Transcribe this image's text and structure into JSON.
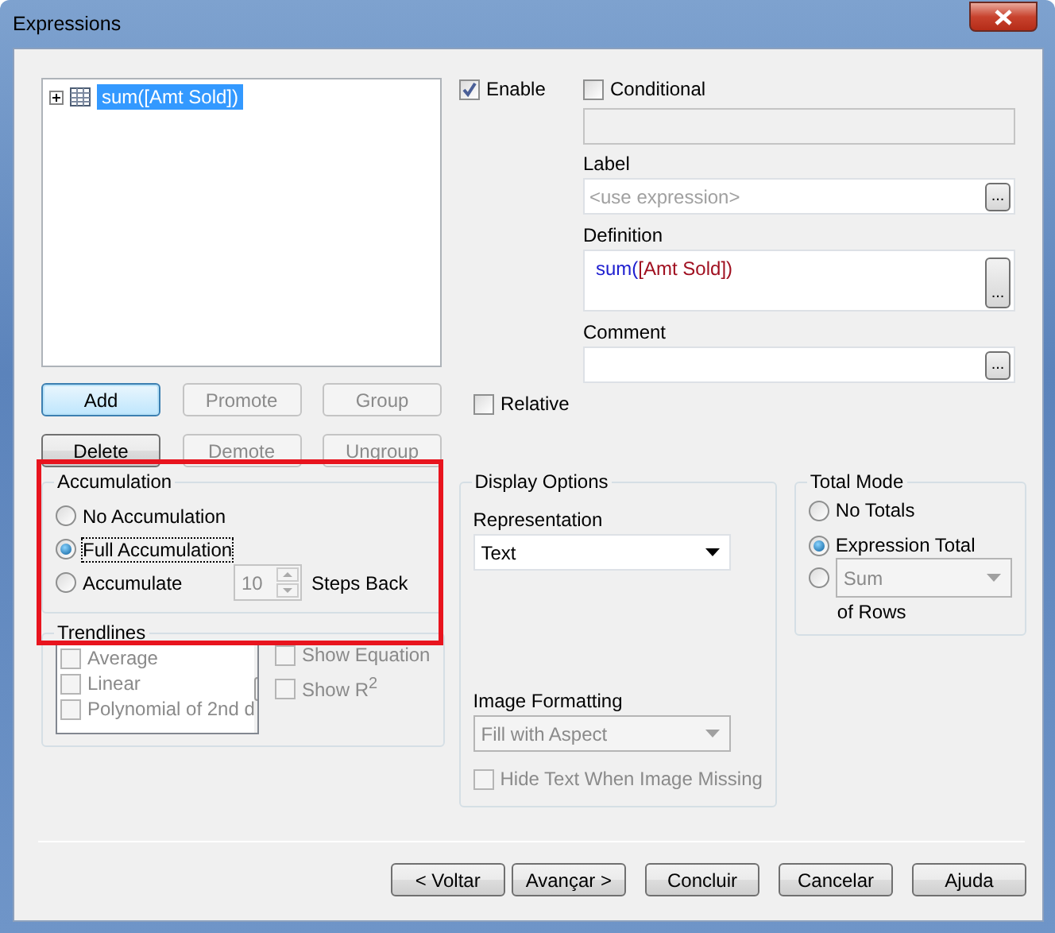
{
  "window": {
    "title": "Expressions"
  },
  "expressions": [
    {
      "label": "sum([Amt Sold])",
      "selected": true,
      "expanded": false
    }
  ],
  "list_buttons": [
    {
      "label": "Add",
      "disabled": false,
      "focused": true
    },
    {
      "label": "Promote",
      "disabled": true,
      "focused": false
    },
    {
      "label": "Group",
      "disabled": true,
      "focused": false
    },
    {
      "label": "Delete",
      "disabled": false,
      "focused": false
    },
    {
      "label": "Demote",
      "disabled": true,
      "focused": false
    },
    {
      "label": "Ungroup",
      "disabled": true,
      "focused": false
    }
  ],
  "enable": {
    "label": "Enable",
    "checked": true
  },
  "conditional": {
    "label": "Conditional",
    "checked": false
  },
  "label_field": {
    "label": "Label",
    "placeholder": "<use expression>",
    "button": "..."
  },
  "definition": {
    "label": "Definition",
    "button": "...",
    "tokens": [
      {
        "text": "sum(",
        "color": "#2020d0"
      },
      {
        "text": "[Amt Sold])",
        "color": "#a01020"
      }
    ]
  },
  "comment": {
    "label": "Comment",
    "button": "..."
  },
  "relative": {
    "label": "Relative",
    "checked": false
  },
  "accumulation": {
    "title": "Accumulation",
    "options": [
      {
        "label": "No Accumulation",
        "selected": false
      },
      {
        "label": "Full Accumulation",
        "selected": true
      },
      {
        "label": "Accumulate",
        "selected": false
      }
    ],
    "steps": "10",
    "steps_label": "Steps Back"
  },
  "trendlines": {
    "title": "Trendlines",
    "items": [
      {
        "label": "Average",
        "checked": false
      },
      {
        "label": "Linear",
        "checked": false
      },
      {
        "label": "Polynomial of 2nd d",
        "checked": false
      }
    ],
    "options": [
      {
        "label": "Show Equation",
        "checked": false
      },
      {
        "label": "Show R$^{2}$",
        "checked": false
      }
    ]
  },
  "display_options": {
    "title": "Display Options",
    "representation_label": "Representation",
    "representation": "Text",
    "image_formatting_label": "Image Formatting",
    "image_formatting": "Fill with Aspect",
    "hide_text": {
      "label": "Hide Text When Image Missing",
      "checked": false,
      "disabled": true
    }
  },
  "total_mode": {
    "title": "Total Mode",
    "options": [
      {
        "kind": "label",
        "label": "No Totals",
        "selected": false
      },
      {
        "kind": "label",
        "label": "Expression Total",
        "selected": true
      },
      {
        "kind": "select",
        "value": "Sum",
        "selected": false
      }
    ],
    "suffix": "of Rows"
  },
  "footer": {
    "navigation": [
      {
        "label": "< Voltar"
      },
      {
        "label": "Avançar >"
      }
    ],
    "actions": [
      {
        "label": "Concluir"
      },
      {
        "label": "Cancelar"
      },
      {
        "label": "Ajuda"
      }
    ]
  }
}
